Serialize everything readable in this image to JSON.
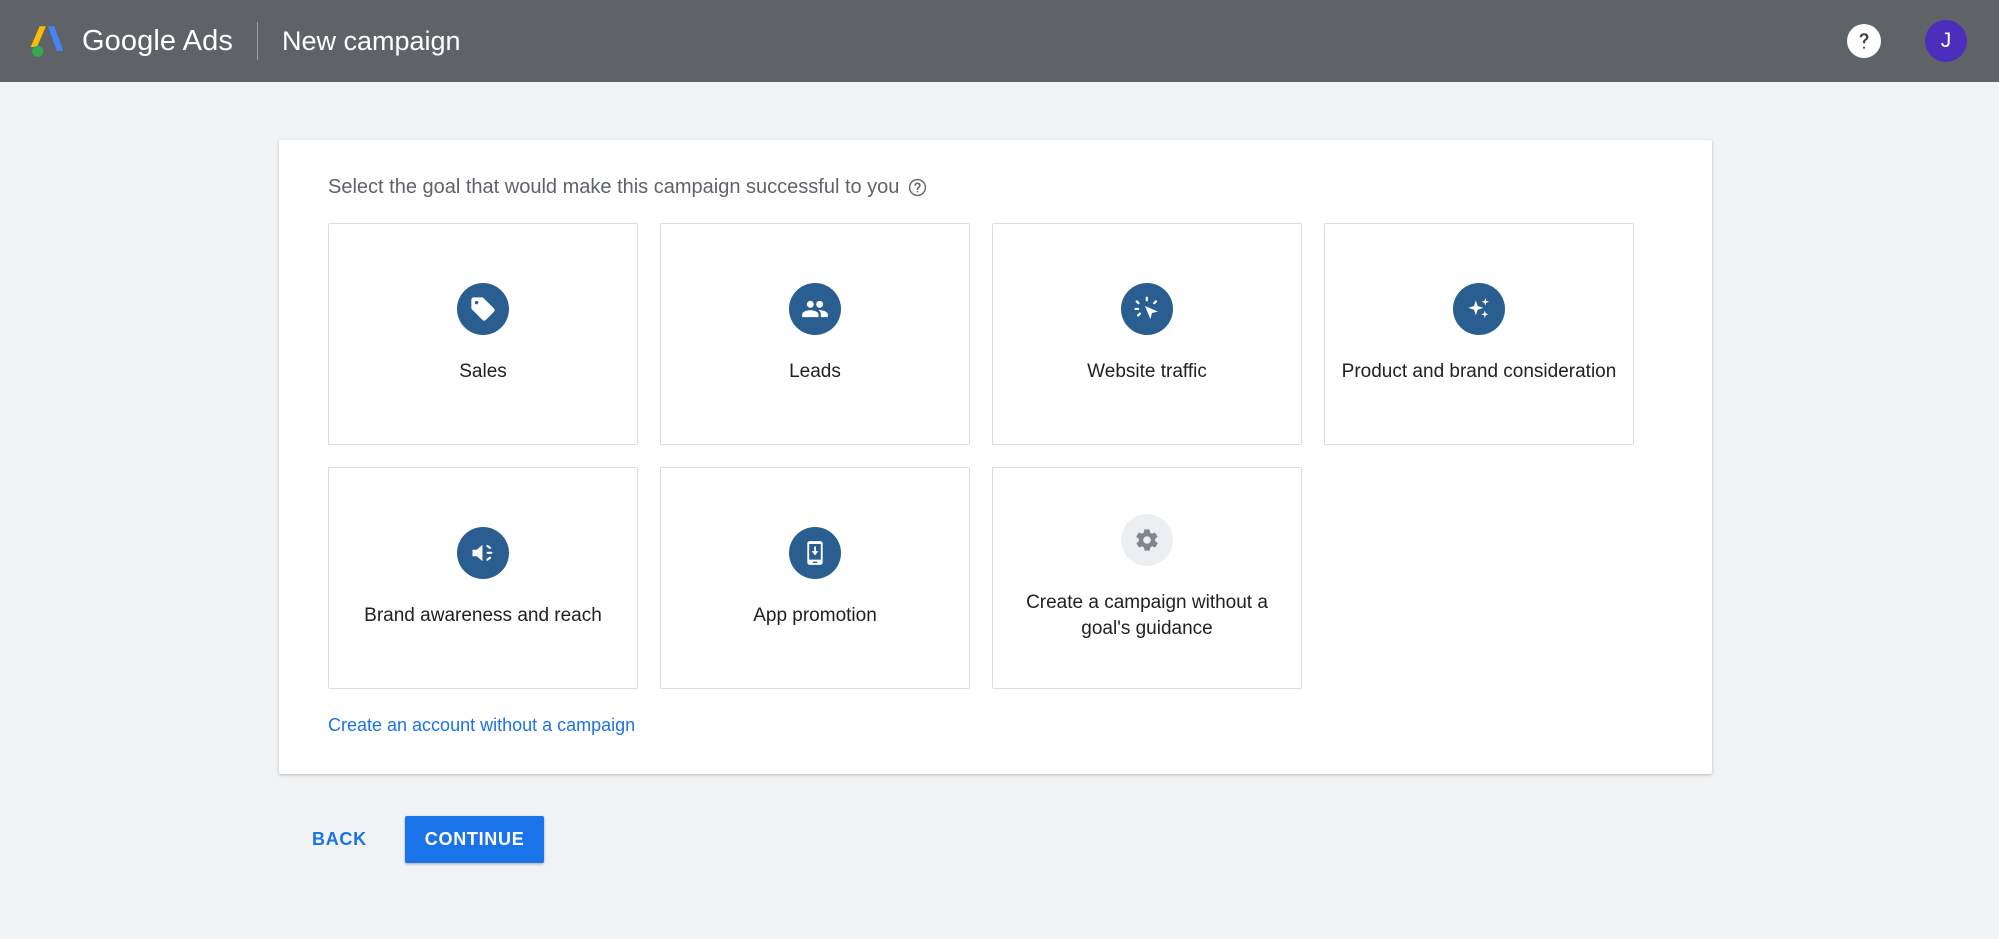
{
  "header": {
    "brand_name": "Google Ads",
    "page_subject": "New campaign",
    "help_icon": "help-circle-icon",
    "avatar_initial": "J",
    "bar_color": "#5f6368",
    "avatar_color": "#4b2ebb"
  },
  "panel": {
    "heading": "Select the goal that would make this campaign successful to you",
    "heading_help_icon": "help-outline-icon",
    "goals": [
      {
        "label": "Sales",
        "icon": "price-tag-icon",
        "style": "primary"
      },
      {
        "label": "Leads",
        "icon": "people-group-icon",
        "style": "primary"
      },
      {
        "label": "Website traffic",
        "icon": "cursor-click-icon",
        "style": "primary"
      },
      {
        "label": "Product and brand consideration",
        "icon": "sparkles-icon",
        "style": "primary"
      },
      {
        "label": "Brand awareness and reach",
        "icon": "speaker-volume-icon",
        "style": "primary"
      },
      {
        "label": "App promotion",
        "icon": "mobile-download-icon",
        "style": "primary"
      },
      {
        "label": "Create a campaign without a goal's guidance",
        "icon": "gear-icon",
        "style": "neutral"
      }
    ],
    "no_campaign_link": "Create an account without a campaign"
  },
  "actions": {
    "back_label": "BACK",
    "continue_label": "CONTINUE",
    "accent_color": "#1a73e8"
  }
}
